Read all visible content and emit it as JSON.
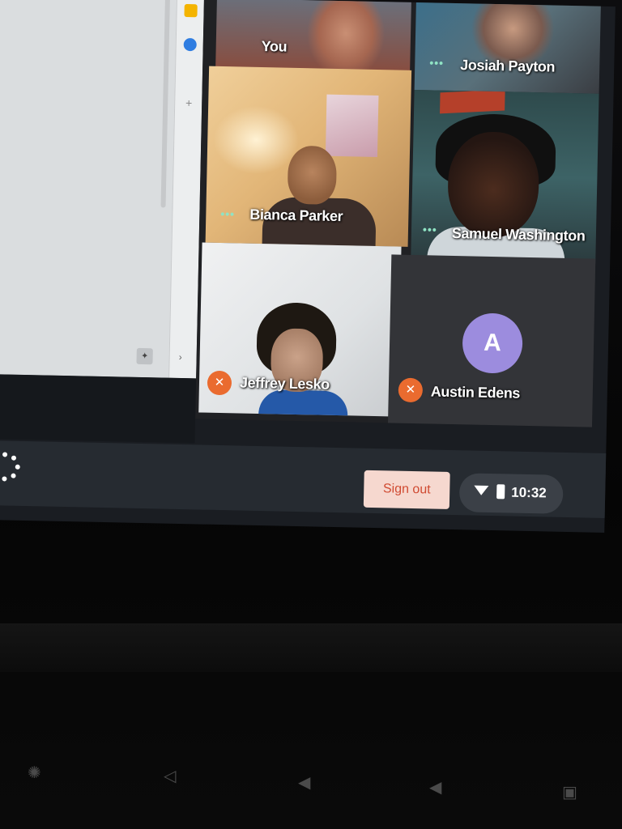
{
  "participants": [
    {
      "name": "You",
      "muted": false
    },
    {
      "name": "Josiah Payton",
      "muted": false,
      "indicator": "•••"
    },
    {
      "name": "Bianca Parker",
      "muted": false,
      "indicator": "•••"
    },
    {
      "name": "Samuel Washington",
      "muted": false,
      "indicator": "•••"
    },
    {
      "name": "Jeffrey Lesko",
      "muted": true
    },
    {
      "name": "Austin Edens",
      "muted": true,
      "avatar_letter": "A",
      "avatar_color": "#9c8cde"
    }
  ],
  "shelf": {
    "sign_out_label": "Sign out",
    "time": "10:32",
    "sign_out_bg": "#f6d8cf",
    "sign_out_text_color": "#d04a31"
  },
  "colors": {
    "mute_badge": "#ea6b2f",
    "audio_indicator": "#8fe3c4"
  },
  "icons": {
    "mute": "microphone-off-icon",
    "wifi": "wifi-icon",
    "battery": "battery-icon",
    "launcher": "launcher-icon"
  }
}
